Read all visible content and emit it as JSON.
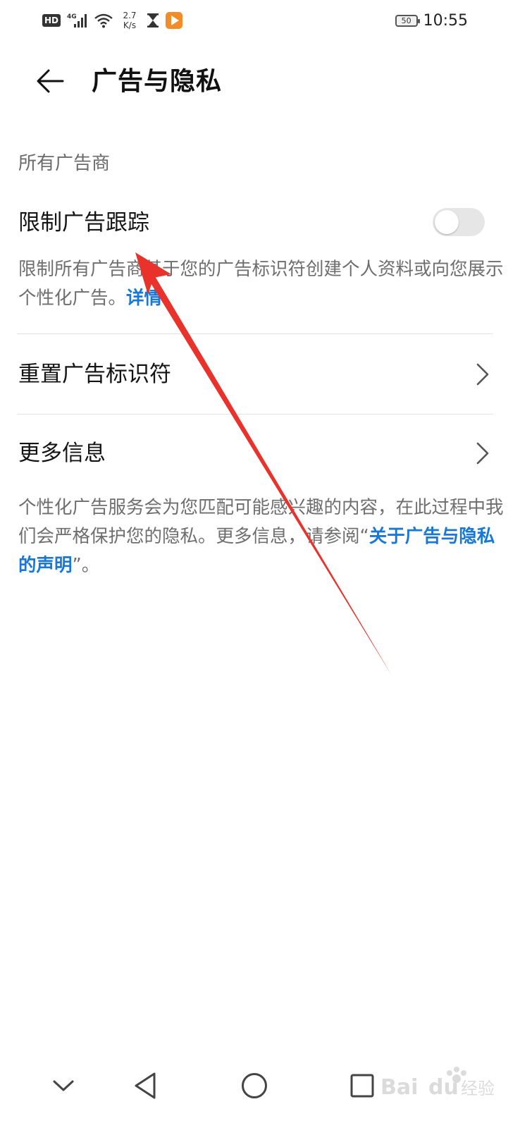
{
  "status_bar": {
    "hd_badge": "HD",
    "network": "4G",
    "speed_value": "2.7",
    "speed_unit": "K/s",
    "battery": "50",
    "time": "10:55",
    "icons": [
      "hd-icon",
      "signal-4g-icon",
      "wifi-icon",
      "net-speed",
      "hourglass-icon",
      "video-app-icon",
      "battery-icon"
    ]
  },
  "app_bar": {
    "title": "广告与隐私",
    "back_icon": "back-arrow-icon"
  },
  "section": {
    "header": "所有广告商"
  },
  "limit_tracking": {
    "label": "限制广告跟踪",
    "enabled": false,
    "description": "限制所有广告商基于您的广告标识符创建个人资料或向您展示个性化广告。",
    "link_text": "详情"
  },
  "reset_id": {
    "label": "重置广告标识符",
    "icon": "chevron-right-icon"
  },
  "more_info": {
    "label": "更多信息",
    "icon": "chevron-right-icon"
  },
  "footer_note": {
    "text_before": "个性化广告服务会为您匹配可能感兴趣的内容，在此过程中我们会严格保护您的隐私。更多信息，请参阅“",
    "link_text": "关于广告与隐私的声明",
    "text_after": "”。"
  },
  "nav_bar": {
    "buttons": [
      "collapse-chevron-icon",
      "back-triangle-icon",
      "home-circle-icon",
      "recents-square-icon"
    ]
  },
  "colors": {
    "link": "#1878d8",
    "annotation_arrow": "#e8322b",
    "toggle_off": "#e6e6e6"
  }
}
